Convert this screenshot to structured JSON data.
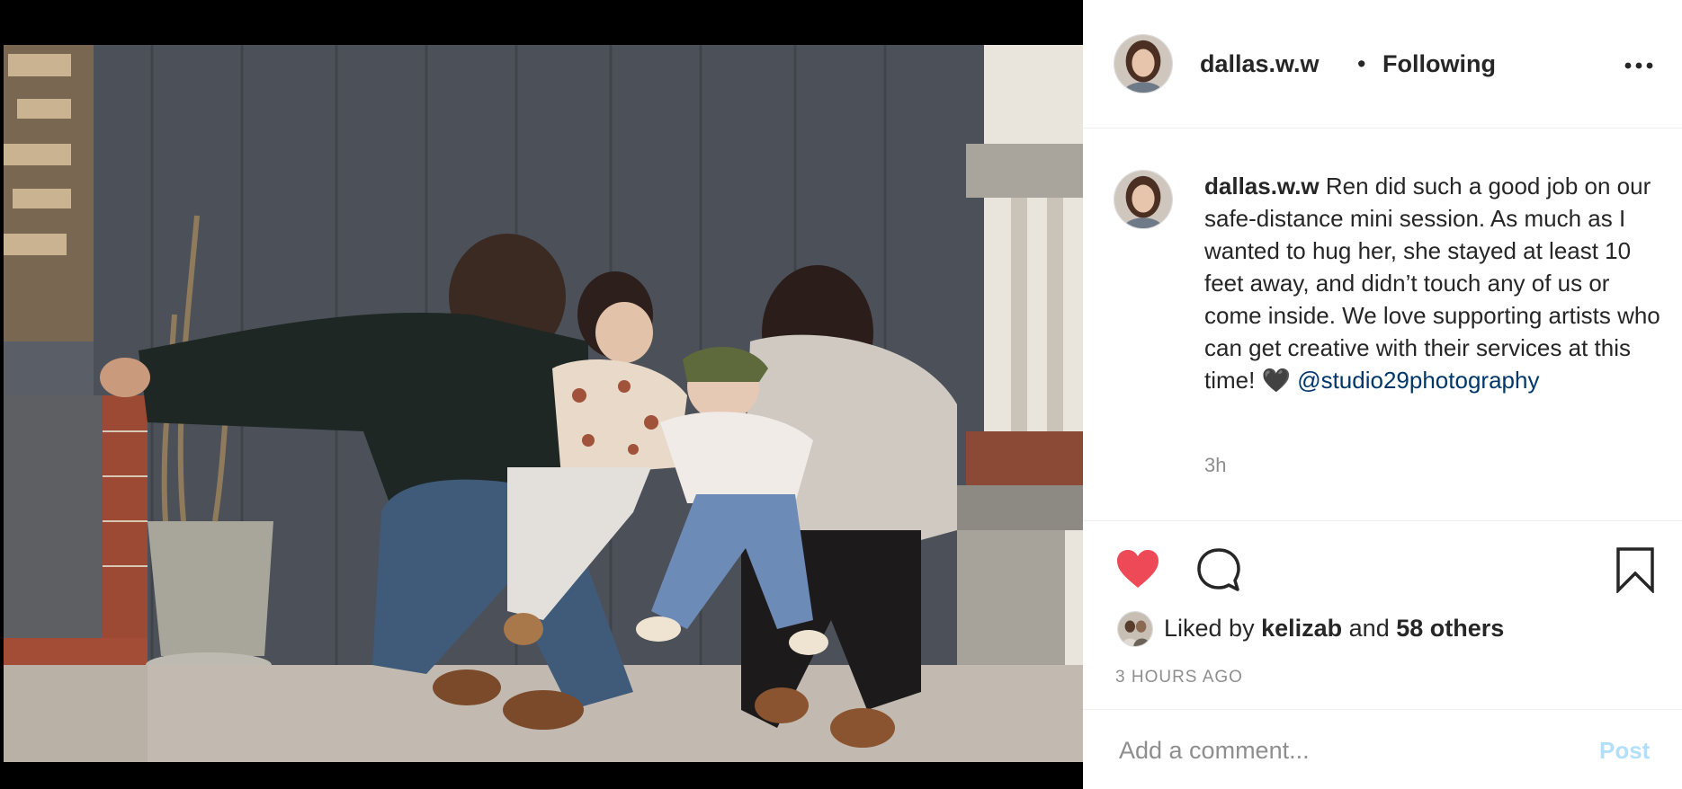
{
  "post": {
    "username": "dallas.w.w",
    "separator": "•",
    "follow_status": "Following",
    "more_icon": "more-horizontal-icon"
  },
  "caption": {
    "username": "dallas.w.w",
    "text": "Ren did such a good job on our safe-distance mini session. As much as I wanted to hug her, she stayed at least 10 feet away, and didn’t touch any of us or come inside. We love supporting artists who can get creative with their services at this time!",
    "emoji": "🖤",
    "mention": "@studio29photography",
    "time": "3h"
  },
  "actions": {
    "like_icon": "heart-filled-icon",
    "comment_icon": "comment-bubble-icon",
    "save_icon": "bookmark-icon",
    "liked": true,
    "like_color": "#ed4956"
  },
  "likes": {
    "prefix": "Liked by",
    "first_user": "kelizab",
    "conjunction": "and",
    "others": "58 others"
  },
  "timestamp": "3 HOURS AGO",
  "comment_box": {
    "placeholder": "Add a comment...",
    "post_label": "Post",
    "post_color": "#b2dffc"
  }
}
